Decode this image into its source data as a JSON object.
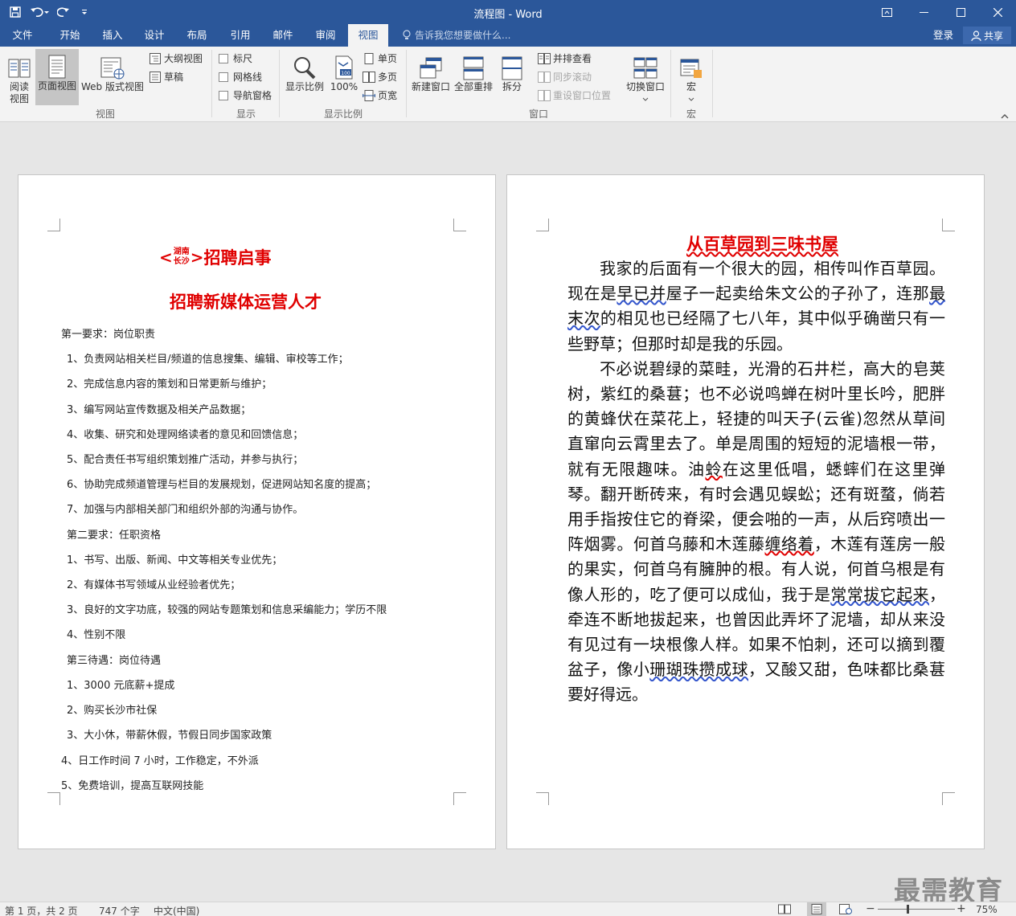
{
  "window": {
    "title": "流程图 - Word"
  },
  "tabs": [
    {
      "label": "文件",
      "active": false
    },
    {
      "label": "开始",
      "active": false
    },
    {
      "label": "插入",
      "active": false
    },
    {
      "label": "设计",
      "active": false
    },
    {
      "label": "布局",
      "active": false
    },
    {
      "label": "引用",
      "active": false
    },
    {
      "label": "邮件",
      "active": false
    },
    {
      "label": "审阅",
      "active": false
    },
    {
      "label": "视图",
      "active": true
    }
  ],
  "tell_me": {
    "placeholder": "告诉我您想要做什么..."
  },
  "account": {
    "login": "登录",
    "share": "共享"
  },
  "ribbon": {
    "views": {
      "read_mode_line1": "阅读",
      "read_mode_line2": "视图",
      "print_layout": "页面视图",
      "web_layout": "Web 版式视图",
      "outline": "大纲视图",
      "draft": "草稿",
      "group_label": "视图"
    },
    "show": {
      "ruler": "标尺",
      "gridlines": "网格线",
      "nav_pane": "导航窗格",
      "group_label": "显示"
    },
    "zoom": {
      "zoom": "显示比例",
      "hundred": "100%",
      "one_page": "单页",
      "multi_page": "多页",
      "page_width": "页宽",
      "group_label": "显示比例"
    },
    "window": {
      "new_window": "新建窗口",
      "arrange_all": "全部重排",
      "split": "拆分",
      "side_by_side": "并排查看",
      "sync_scroll": "同步滚动",
      "reset_position": "重设窗口位置",
      "switch_windows": "切换窗口",
      "group_label": "窗口"
    },
    "macros": {
      "macros": "宏",
      "group_label": "宏"
    }
  },
  "page1": {
    "title_lt": "<",
    "title_top": "湖南",
    "title_bottom": "长沙",
    "title_gt": ">",
    "title_main": "招聘启事",
    "subtitle": "招聘新媒体运营人才",
    "lines": [
      "第一要求：岗位职责",
      "1、负责网站相关栏目/频道的信息搜集、编辑、审校等工作；",
      "2、完成信息内容的策划和日常更新与维护；",
      "3、编写网站宣传数据及相关产品数据；",
      "4、收集、研究和处理网络读者的意见和回馈信息；",
      "5、配合责任书写组织策划推广活动，并参与执行；",
      "6、协助完成频道管理与栏目的发展规划，促进网站知名度的提高；",
      "7、加强与内部相关部门和组织外部的沟通与协作。",
      "第二要求：任职资格",
      "1、书写、出版、新闻、中文等相关专业优先；",
      "2、有媒体书写领域从业经验者优先；",
      "3、良好的文字功底，较强的网站专题策划和信息采编能力；学历不限",
      "4、性别不限",
      "第三待遇：岗位待遇",
      "1、3000 元底薪+提成",
      "2、购买长沙市社保",
      "3、大小休，带薪休假，节假日同步国家政策",
      "4、日工作时间 7 小时，工作稳定，不外派",
      "5、免费培训，提高互联网技能"
    ]
  },
  "page2": {
    "title": "从百草园到三味书屋",
    "p1": {
      "a": "我家的后面有一个很大的园，相传叫作百草园。现在是",
      "b": "早已并",
      "c": "屋子一起卖给朱文公的子孙了，连那",
      "d": "最末次",
      "e": "的相见也已经隔了七八年，其中似乎确凿只有一些野草；但那时却是我的乐园。"
    },
    "p2": {
      "a": "不必说碧绿的菜畦，光滑的石井栏，高大的皂荚树，紫红的桑葚；也不必说鸣蝉在树叶里长吟，肥胖的黄蜂伏在菜花上，轻捷的叫天子(云雀)忽然从草间直窜向云霄里去了。单是周围的短短的泥墙根一带，就有无限趣味。油",
      "b": "蛉",
      "c": "在这里低唱，蟋蟀们在这里弹琴。翻开断砖来，有时会遇见蜈蚣；还有斑蝥，倘若用手指按住它的脊梁，便会啪的一声，从后窍喷出一阵烟雾。何首乌藤和木莲藤",
      "d": "缠络着",
      "e": "，木莲有莲房一般的果实，何首乌有臃肿的根。有人说，何首乌根是有像人形的，吃了便可以成仙，我于是",
      "f": "常常拔它起来",
      "g": "，牵连不断地拔起来，也曾因此弄坏了泥墙，却从来没有见过有一块根像人样。如果不怕刺，还可以摘到覆盆子，像小",
      "h": "珊瑚珠攒成球",
      "i": "，又酸又甜，色味都比桑葚要好得远。"
    }
  },
  "status": {
    "page": "第 1 页，共 2 页",
    "words": "747 个字",
    "language": "中文(中国)",
    "zoom": "75%",
    "zoom_fraction": 0.38
  },
  "watermark": "最需教育",
  "colors": {
    "brand": "#2b579a",
    "heading_red": "#e00000"
  }
}
